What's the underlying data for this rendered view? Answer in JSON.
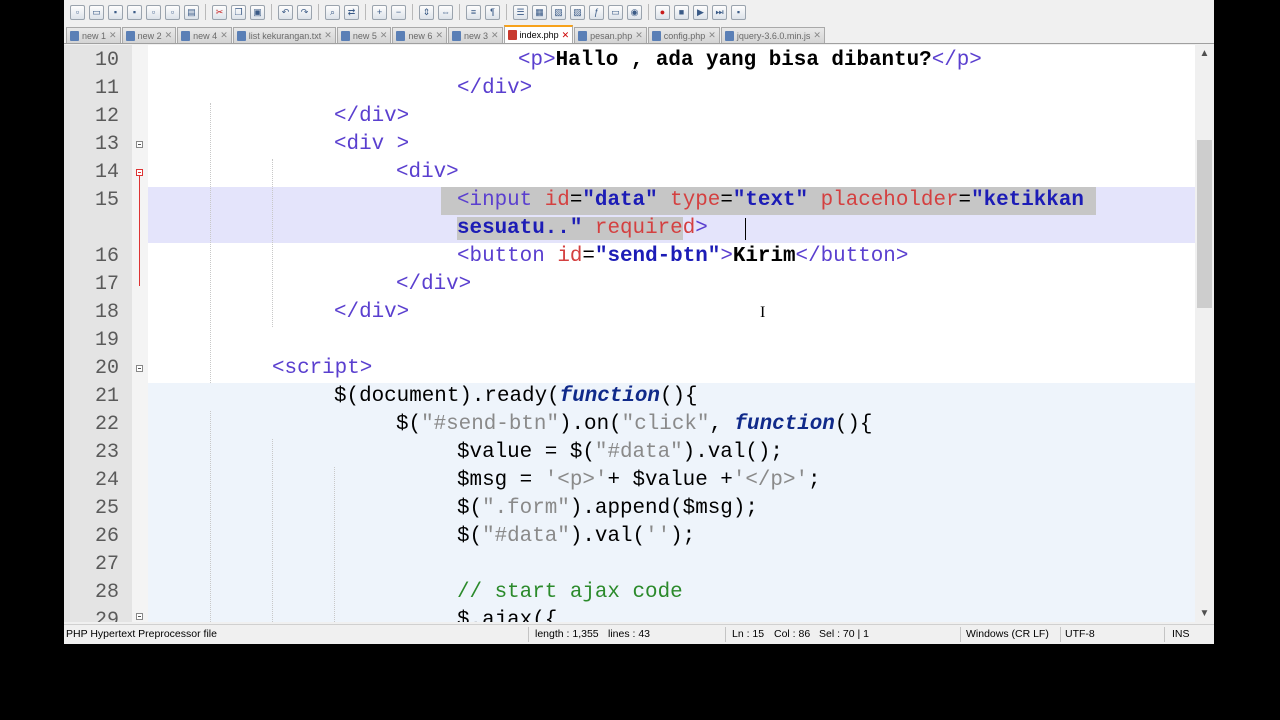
{
  "tabs": [
    {
      "label": "new 1",
      "active": false
    },
    {
      "label": "new 2",
      "active": false
    },
    {
      "label": "new 4",
      "active": false
    },
    {
      "label": "list kekurangan.txt",
      "active": false
    },
    {
      "label": "new 5",
      "active": false
    },
    {
      "label": "new 6",
      "active": false
    },
    {
      "label": "new 3",
      "active": false
    },
    {
      "label": "index.php",
      "active": true
    },
    {
      "label": "pesan.php",
      "active": false
    },
    {
      "label": "config.php",
      "active": false
    },
    {
      "label": "jquery-3.6.0.min.js",
      "active": false
    }
  ],
  "gutter": {
    "line_numbers": [
      "10",
      "11",
      "12",
      "13",
      "14",
      "15",
      "",
      "16",
      "17",
      "18",
      "19",
      "20",
      "21",
      "22",
      "23",
      "24",
      "25",
      "26",
      "27",
      "28",
      "29"
    ]
  },
  "code": {
    "l10": {
      "open": "<p>",
      "text": "Hallo , ada yang bisa dibantu?",
      "close": "</p>"
    },
    "l11": "</div>",
    "l12": "</div>",
    "l13": "<div >",
    "l14": "<div>",
    "l15": {
      "tag": "<input",
      "a1": "id",
      "eq": "=",
      "v1": "\"data\"",
      "a2": "type",
      "v2": "\"text\"",
      "a3": "placeholder",
      "v3a": "\"ketikkan"
    },
    "l15b": {
      "v3b": "sesuatu..\"",
      "a4a": "require",
      "a4b": "d",
      "end": ">"
    },
    "l16": {
      "open": "<button",
      "a1": "id",
      "eq": "=",
      "v1": "\"send-btn\"",
      "gt": ">",
      "text": "Kirim",
      "close": "</button>"
    },
    "l17": "</div>",
    "l18": "</div>",
    "l20": "<script>",
    "l21": {
      "a": "$(document).ready(",
      "kw": "function",
      "b": "(){"
    },
    "l22": {
      "a": "$(",
      "s": "\"#send-btn\"",
      "b": ").on(",
      "s2": "\"click\"",
      "c": ", ",
      "kw": "function",
      "d": "(){"
    },
    "l23": {
      "a": "$value = $(",
      "s": "\"#data\"",
      "b": ").val();"
    },
    "l24": {
      "a": "$msg = ",
      "s": "'<p>'",
      "b": "+ $value +",
      "s2": "'</p>'",
      "c": ";"
    },
    "l25": {
      "a": "$(",
      "s": "\".form\"",
      "b": ").append($msg);"
    },
    "l26": {
      "a": "$(",
      "s": "\"#data\"",
      "b": ").val(",
      "s2": "''",
      "c": ");"
    },
    "l28": "// start ajax code",
    "l29": "$.ajax({"
  },
  "status": {
    "file_type": "PHP Hypertext Preprocessor file",
    "length": "length : 1,355",
    "lines": "lines : 43",
    "ln": "Ln : 15",
    "col": "Col : 86",
    "sel": "Sel : 70 | 1",
    "eol": "Windows (CR LF)",
    "encoding": "UTF-8",
    "mode": "INS"
  },
  "colors": {
    "tag": "#5a3fcf",
    "attribute": "#d44040",
    "string": "#1c1cb6",
    "keyword": "#102a8a",
    "comment": "#2b8a2b",
    "current_line": "#e8e8ff",
    "active_tab_accent": "#f7a21b"
  }
}
